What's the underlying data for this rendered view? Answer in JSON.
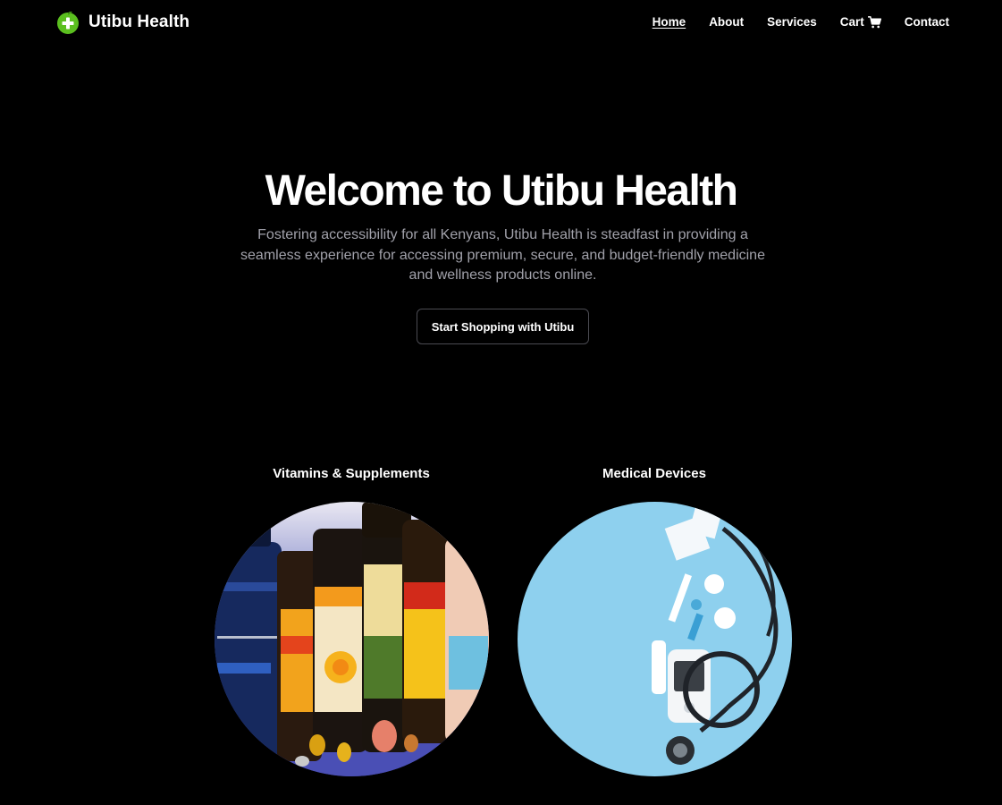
{
  "brand": {
    "name": "Utibu Health",
    "logo_icon": "green-plus-circle-icon",
    "accent_color": "#5bbf1f"
  },
  "nav": {
    "items": [
      {
        "label": "Home",
        "active": true
      },
      {
        "label": "About",
        "active": false
      },
      {
        "label": "Services",
        "active": false
      },
      {
        "label": "Cart",
        "active": false,
        "icon": "cart-icon"
      },
      {
        "label": "Contact",
        "active": false
      }
    ]
  },
  "hero": {
    "title": "Welcome to Utibu Health",
    "text": "Fostering accessibility for all Kenyans, Utibu Health is steadfast in providing a seamless experience for accessing premium, secure, and budget-friendly medicine and wellness products online.",
    "cta_label": "Start Shopping with Utibu"
  },
  "categories": [
    {
      "label": "Vitamins & Supplements",
      "image": "vitamin-bottles-photo"
    },
    {
      "label": "Medical Devices",
      "image": "stethoscope-glucometer-photo"
    }
  ],
  "colors": {
    "background": "#000000",
    "text": "#ffffff",
    "muted_text": "#a1a1aa",
    "button_border": "#4b4b52"
  }
}
